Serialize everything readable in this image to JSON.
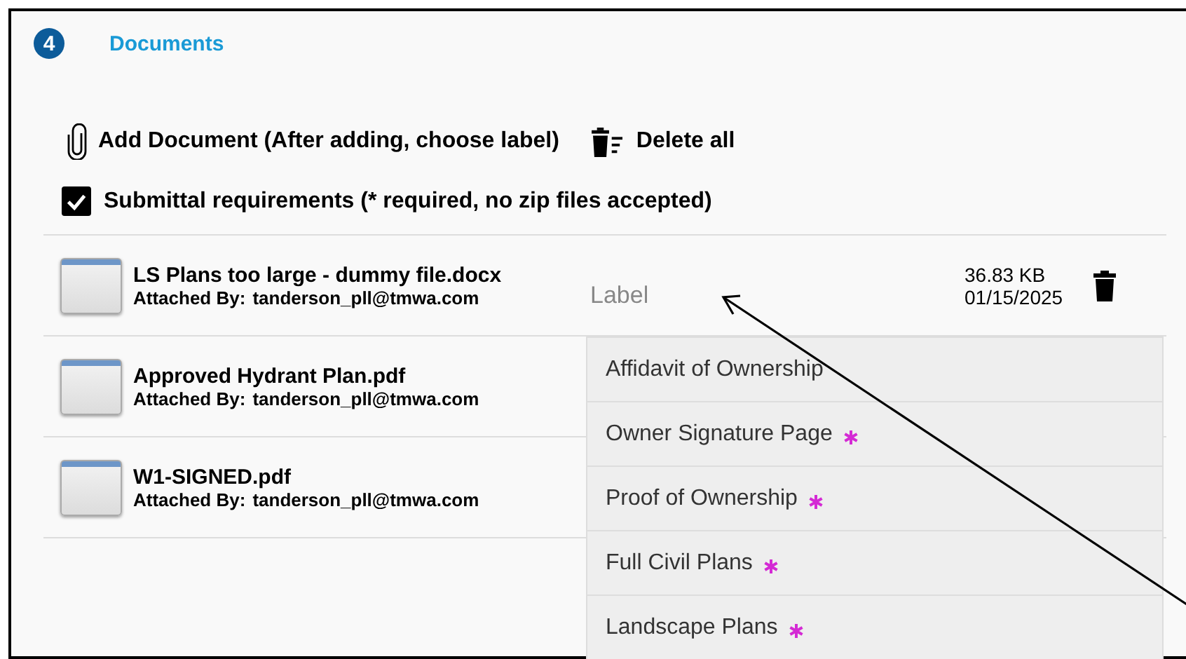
{
  "section": {
    "number": "4",
    "title": "Documents"
  },
  "actions": {
    "add": "Add Document (After adding, choose label)",
    "delete_all": "Delete all"
  },
  "requirements": {
    "label": "Submittal requirements (* required, no zip files accepted)",
    "checked": true
  },
  "documents": [
    {
      "name": "LS Plans too large - dummy file.docx",
      "attached_label": "Attached By:",
      "attached_by": "tanderson_pll@tmwa.com",
      "label_placeholder": "Label",
      "size": "36.83 KB",
      "date": "01/15/2025"
    },
    {
      "name": "Approved Hydrant Plan.pdf",
      "attached_label": "Attached By:",
      "attached_by": "tanderson_pll@tmwa.com"
    },
    {
      "name": "W1-SIGNED.pdf",
      "attached_label": "Attached By:",
      "attached_by": "tanderson_pll@tmwa.com"
    }
  ],
  "label_options": [
    {
      "label": "Affidavit of Ownership",
      "required": false
    },
    {
      "label": "Owner Signature Page",
      "required": true
    },
    {
      "label": "Proof of Ownership",
      "required": true
    },
    {
      "label": "Full Civil Plans",
      "required": true
    },
    {
      "label": "Landscape Plans",
      "required": true
    }
  ]
}
